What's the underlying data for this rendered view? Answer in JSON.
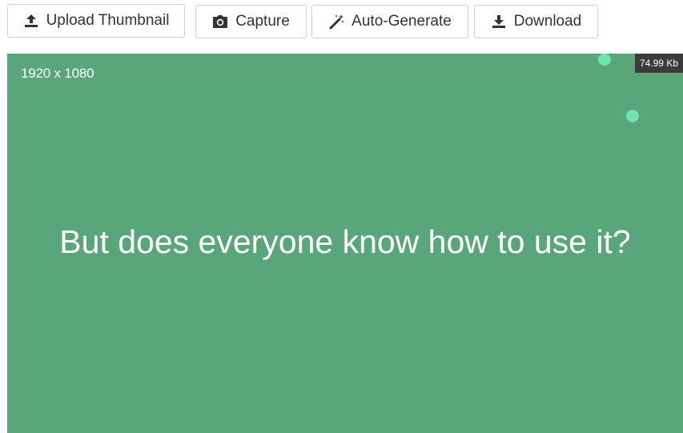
{
  "toolbar": {
    "buttons": [
      {
        "label": "Upload Thumbnail",
        "icon": "upload-icon"
      },
      {
        "label": "Capture",
        "icon": "camera-icon"
      },
      {
        "label": "Auto-Generate",
        "icon": "magic-wand-icon"
      },
      {
        "label": "Download",
        "icon": "download-icon"
      }
    ]
  },
  "preview": {
    "resolution": "1920 x 1080",
    "file_size": "74.99 Kb",
    "slide_text": "But does everyone know how to use it?"
  },
  "colors": {
    "preview_background": "#5aa67b",
    "dot": "#6fe3b0",
    "button_text": "#333333",
    "badge_background": "#3b3b3b"
  }
}
